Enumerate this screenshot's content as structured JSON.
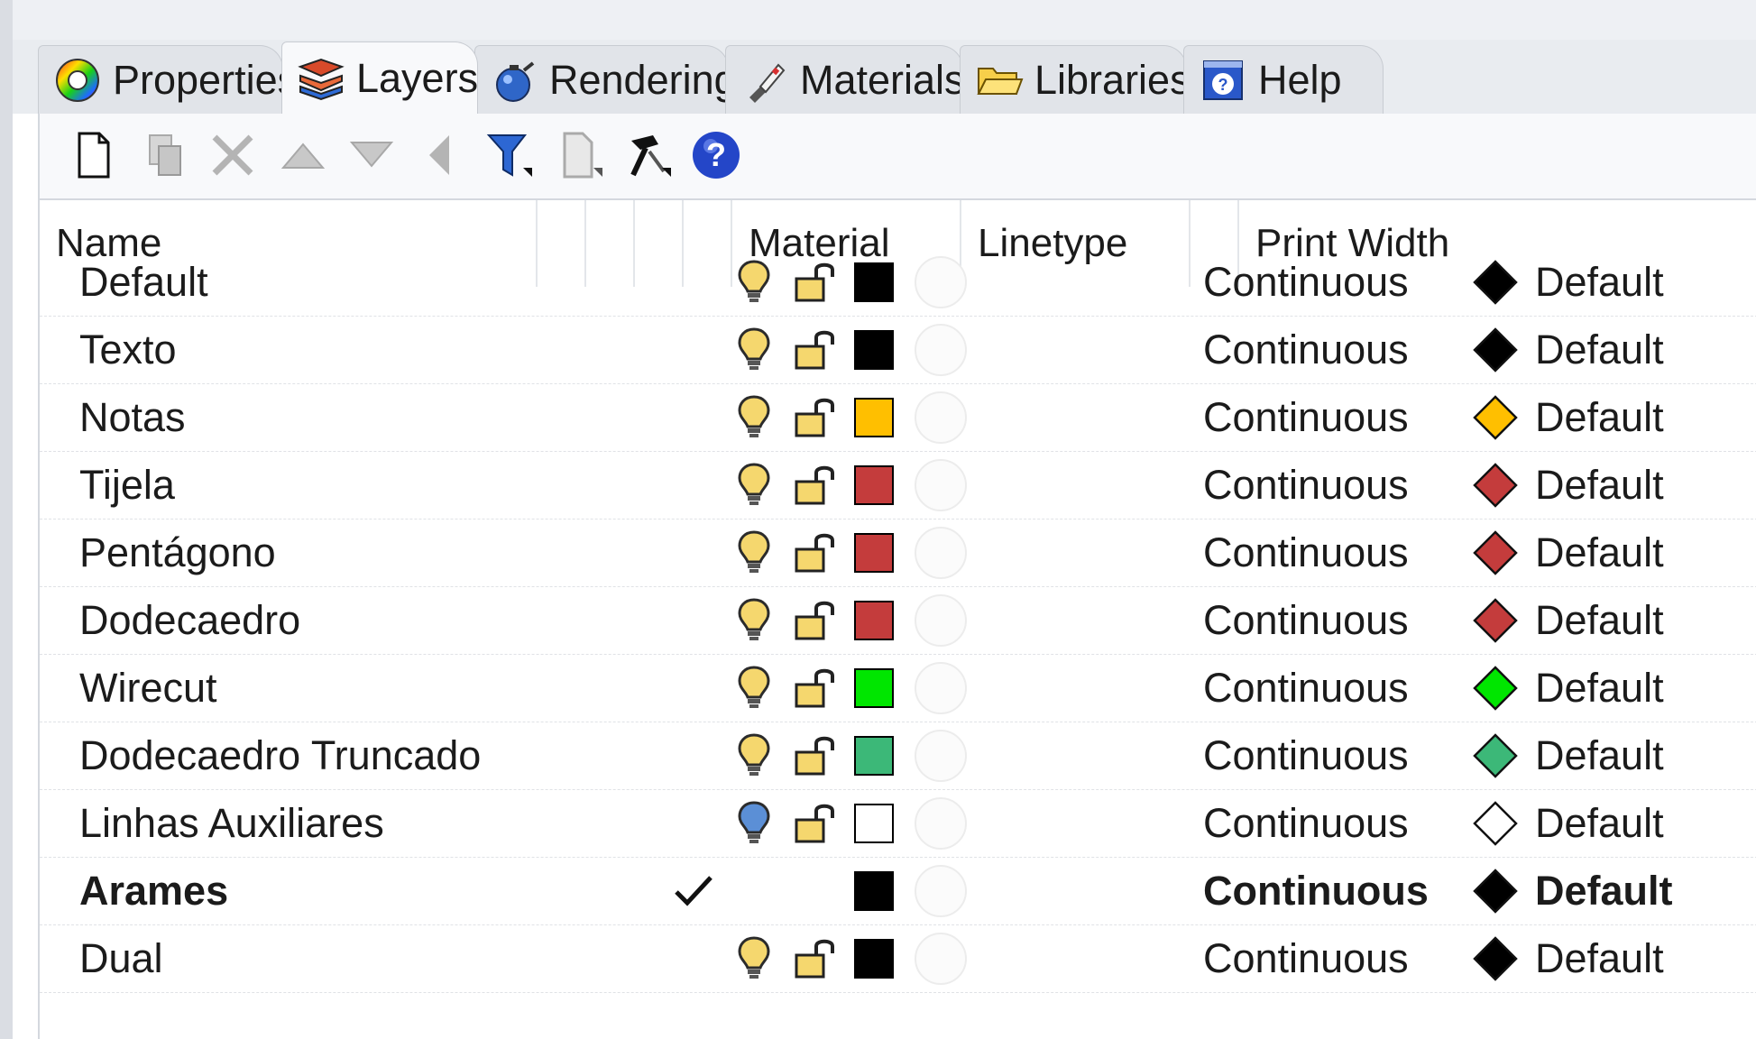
{
  "tabs": [
    {
      "label": "Properties",
      "icon": "color-wheel-icon",
      "active": false
    },
    {
      "label": "Layers",
      "icon": "layers-icon",
      "active": true
    },
    {
      "label": "Rendering",
      "icon": "teapot-icon",
      "active": false
    },
    {
      "label": "Materials",
      "icon": "brush-icon",
      "active": false
    },
    {
      "label": "Libraries",
      "icon": "folder-icon",
      "active": false
    },
    {
      "label": "Help",
      "icon": "help-book-icon",
      "active": false
    }
  ],
  "toolbar": {
    "buttons": [
      "new-layer-icon",
      "new-sublayer-icon",
      "delete-icon",
      "move-up-icon",
      "move-down-icon",
      "move-to-parent-icon",
      "filter-icon",
      "page-icon",
      "tools-hammer-icon",
      "help-icon"
    ]
  },
  "table": {
    "columns": {
      "name": "Name",
      "material": "Material",
      "linetype": "Linetype",
      "print_width": "Print Width"
    },
    "rows": [
      {
        "name": "Default",
        "current": false,
        "visible": true,
        "color": "#000000",
        "linetype": "Continuous",
        "print_width": "Default"
      },
      {
        "name": "Texto",
        "current": false,
        "visible": true,
        "color": "#000000",
        "linetype": "Continuous",
        "print_width": "Default"
      },
      {
        "name": "Notas",
        "current": false,
        "visible": true,
        "color": "#ffbf00",
        "linetype": "Continuous",
        "print_width": "Default"
      },
      {
        "name": "Tijela",
        "current": false,
        "visible": true,
        "color": "#c43c3c",
        "linetype": "Continuous",
        "print_width": "Default"
      },
      {
        "name": "Pentágono",
        "current": false,
        "visible": true,
        "color": "#c43c3c",
        "linetype": "Continuous",
        "print_width": "Default"
      },
      {
        "name": "Dodecaedro",
        "current": false,
        "visible": true,
        "color": "#c43c3c",
        "linetype": "Continuous",
        "print_width": "Default"
      },
      {
        "name": "Wirecut",
        "current": false,
        "visible": true,
        "color": "#00e600",
        "linetype": "Continuous",
        "print_width": "Default"
      },
      {
        "name": "Dodecaedro Truncado",
        "current": false,
        "visible": true,
        "color": "#3cb878",
        "linetype": "Continuous",
        "print_width": "Default"
      },
      {
        "name": "Linhas Auxiliares",
        "current": false,
        "visible": false,
        "color": "#ffffff",
        "linetype": "Continuous",
        "print_width": "Default"
      },
      {
        "name": "Arames",
        "current": true,
        "visible": true,
        "color": "#000000",
        "linetype": "Continuous",
        "print_width": "Default"
      },
      {
        "name": "Dual",
        "current": false,
        "visible": true,
        "color": "#000000",
        "linetype": "Continuous",
        "print_width": "Default"
      }
    ]
  },
  "colors": {
    "accent": "#2b5fd9",
    "bulb_on": "#f5d76e",
    "bulb_off": "#5b8fd6",
    "lock": "#f5d76e"
  }
}
